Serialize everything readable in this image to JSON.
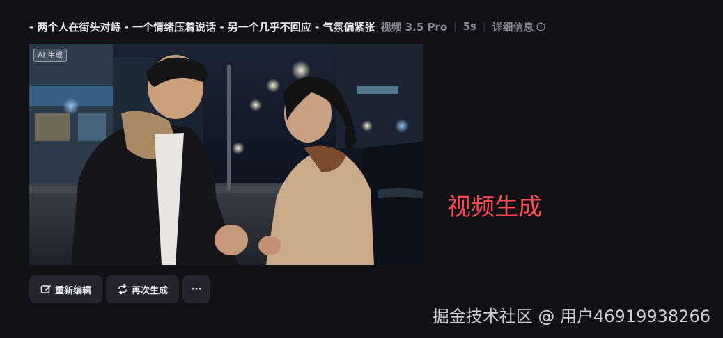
{
  "header": {
    "title": "- 两个人在街头对峙 - 一个情绪压着说话 - 另一个几乎不回应 - 气氛偏紧张",
    "model": "视频 3.5 Pro",
    "duration": "5s",
    "details_label": "详细信息"
  },
  "video": {
    "ai_badge": "AI 生成"
  },
  "actions": {
    "edit_label": "重新编辑",
    "regenerate_label": "再次生成",
    "more_label": "···"
  },
  "overlay_text": "视频生成",
  "watermark": "掘金技术社区 @ 用户46919938266",
  "colors": {
    "background": "#121116",
    "button_bg": "#25242c",
    "overlay_red": "#ff4b4f"
  }
}
